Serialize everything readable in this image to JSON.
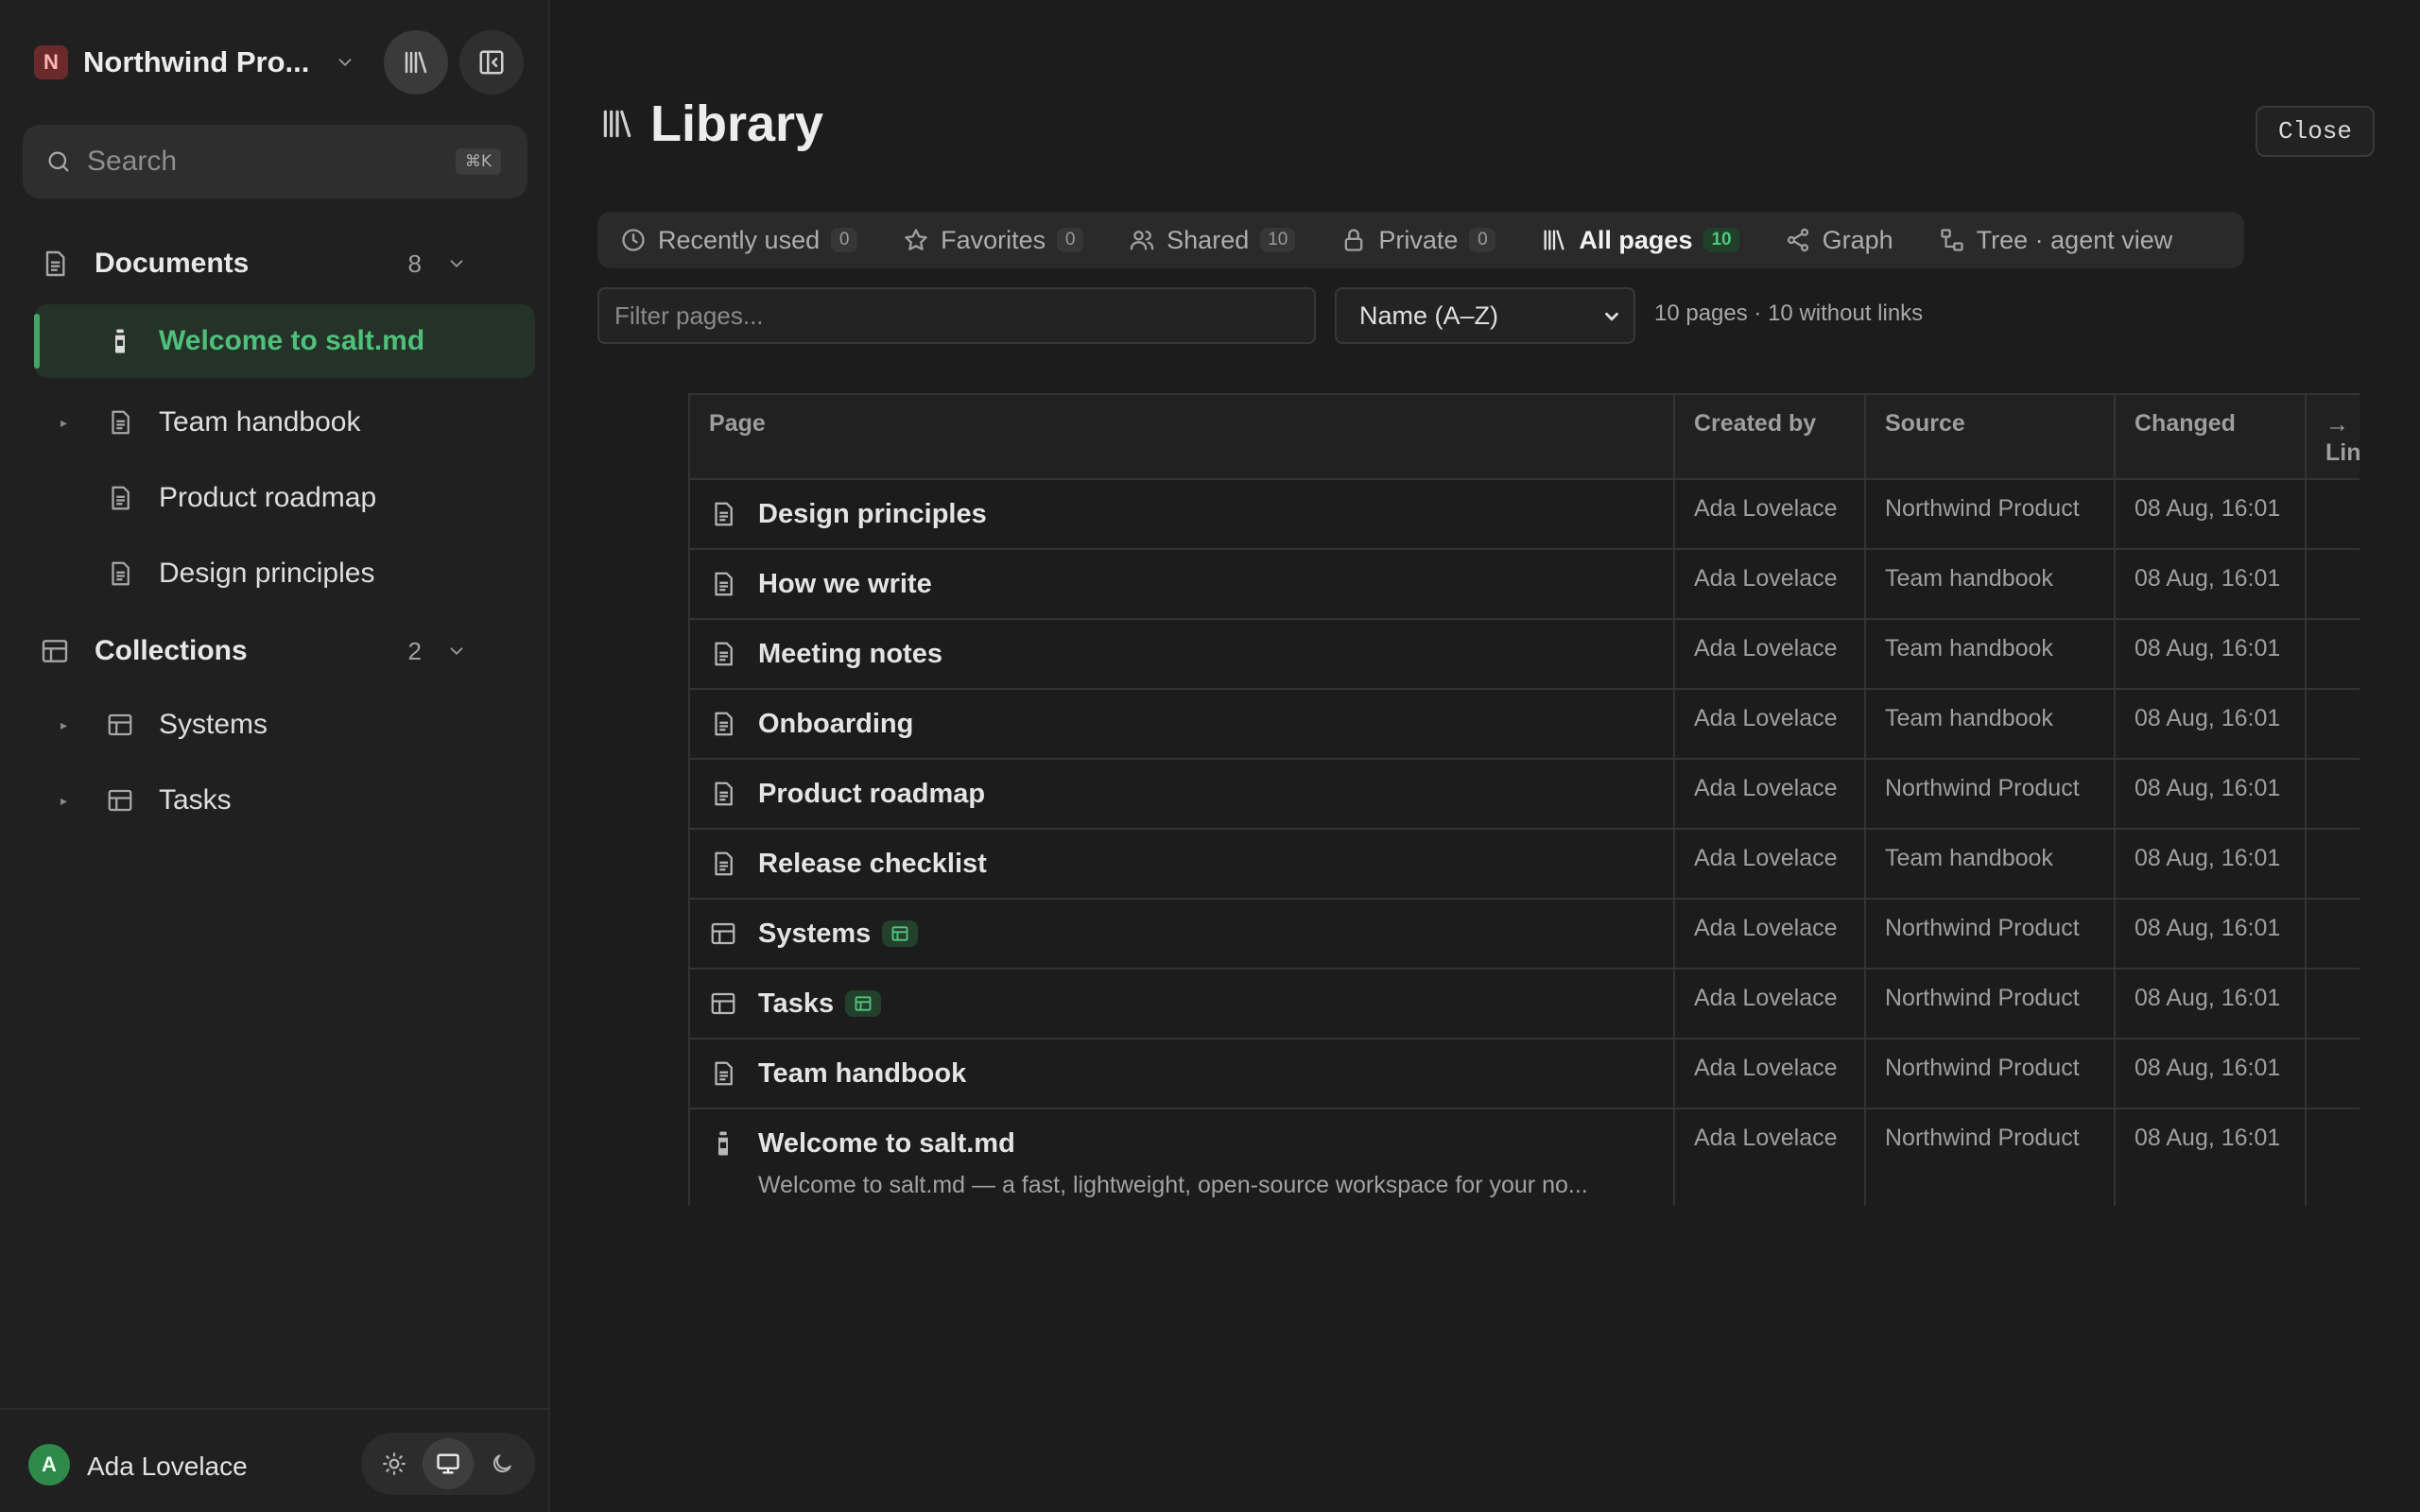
{
  "sidebar": {
    "workspace": {
      "initial": "N",
      "name": "Northwind Pro..."
    },
    "search": {
      "placeholder": "Search",
      "shortcut": "⌘K"
    },
    "documents": {
      "label": "Documents",
      "count": "8",
      "items": [
        {
          "label": "Welcome to salt.md",
          "icon": "bottle-icon",
          "active": true
        },
        {
          "label": "Team handbook",
          "icon": "document-icon"
        },
        {
          "label": "Product roadmap",
          "icon": "document-icon"
        },
        {
          "label": "Design principles",
          "icon": "document-icon"
        }
      ]
    },
    "collections": {
      "label": "Collections",
      "count": "2",
      "items": [
        {
          "label": "Systems",
          "icon": "table-icon"
        },
        {
          "label": "Tasks",
          "icon": "table-icon"
        }
      ]
    },
    "user": {
      "initial": "A",
      "name": "Ada Lovelace"
    },
    "theme": {
      "selected": "system"
    }
  },
  "main": {
    "title": "Library",
    "close_label": "Close",
    "tabs": [
      {
        "label": "Recently used",
        "count": "0",
        "icon": "clock-icon"
      },
      {
        "label": "Favorites",
        "count": "0",
        "icon": "star-icon"
      },
      {
        "label": "Shared",
        "count": "10",
        "icon": "users-icon"
      },
      {
        "label": "Private",
        "count": "0",
        "icon": "lock-icon"
      },
      {
        "label": "All pages",
        "count": "10",
        "icon": "library-icon",
        "active": true
      },
      {
        "label": "Graph",
        "icon": "share-icon"
      },
      {
        "label": "Tree · agent view",
        "icon": "tree-icon"
      }
    ],
    "filter_placeholder": "Filter pages...",
    "sort_value": "Name (A–Z)",
    "summary": "10 pages · 10 without links",
    "table": {
      "headers": {
        "page": "Page",
        "created_by": "Created by",
        "source": "Source",
        "changed": "Changed",
        "links_arrow": "→",
        "links": "Links"
      },
      "rows": [
        {
          "name": "Design principles",
          "icon": "document-icon",
          "created_by": "Ada Lovelace",
          "source": "Northwind Product",
          "changed": "08 Aug, 16:01"
        },
        {
          "name": "How we write",
          "icon": "document-icon",
          "created_by": "Ada Lovelace",
          "source": "Team handbook",
          "changed": "08 Aug, 16:01"
        },
        {
          "name": "Meeting notes",
          "icon": "document-icon",
          "created_by": "Ada Lovelace",
          "source": "Team handbook",
          "changed": "08 Aug, 16:01"
        },
        {
          "name": "Onboarding",
          "icon": "document-icon",
          "created_by": "Ada Lovelace",
          "source": "Team handbook",
          "changed": "08 Aug, 16:01"
        },
        {
          "name": "Product roadmap",
          "icon": "document-icon",
          "created_by": "Ada Lovelace",
          "source": "Northwind Product",
          "changed": "08 Aug, 16:01"
        },
        {
          "name": "Release checklist",
          "icon": "document-icon",
          "created_by": "Ada Lovelace",
          "source": "Team handbook",
          "changed": "08 Aug, 16:01"
        },
        {
          "name": "Systems",
          "icon": "table-icon",
          "collection": true,
          "created_by": "Ada Lovelace",
          "source": "Northwind Product",
          "changed": "08 Aug, 16:01"
        },
        {
          "name": "Tasks",
          "icon": "table-icon",
          "collection": true,
          "created_by": "Ada Lovelace",
          "source": "Northwind Product",
          "changed": "08 Aug, 16:01"
        },
        {
          "name": "Team handbook",
          "icon": "document-icon",
          "created_by": "Ada Lovelace",
          "source": "Northwind Product",
          "changed": "08 Aug, 16:01"
        },
        {
          "name": "Welcome to salt.md",
          "icon": "bottle-icon",
          "description": "Welcome to salt.md — a fast, lightweight, open-source workspace for your no...",
          "created_by": "Ada Lovelace",
          "source": "Northwind Product",
          "changed": "08 Aug, 16:01"
        }
      ]
    }
  },
  "colors": {
    "accent": "#4fc07a",
    "accent_bg": "#243228",
    "workspace_badge": "#6b2a2a",
    "avatar": "#2f8a4a"
  }
}
